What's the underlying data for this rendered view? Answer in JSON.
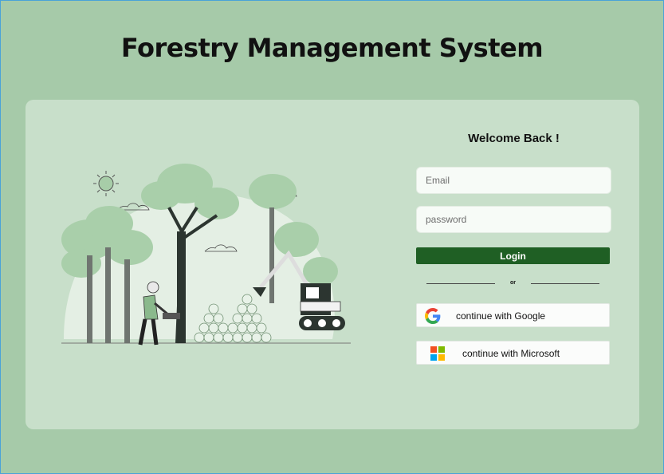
{
  "header": {
    "title": "Forestry Management System"
  },
  "login": {
    "welcome": "Welcome Back !",
    "email_placeholder": "Email",
    "password_placeholder": "password",
    "login_label": "Login",
    "divider_text": "or",
    "google_label": "continue with Google",
    "microsoft_label": "continue with Microsoft"
  },
  "icons": {
    "illustration": "forestry-illustration",
    "google": "google-logo-icon",
    "microsoft": "microsoft-logo-icon"
  },
  "colors": {
    "background": "#a6caa9",
    "card": "#c8dfca",
    "login_button": "#1f5f24"
  }
}
